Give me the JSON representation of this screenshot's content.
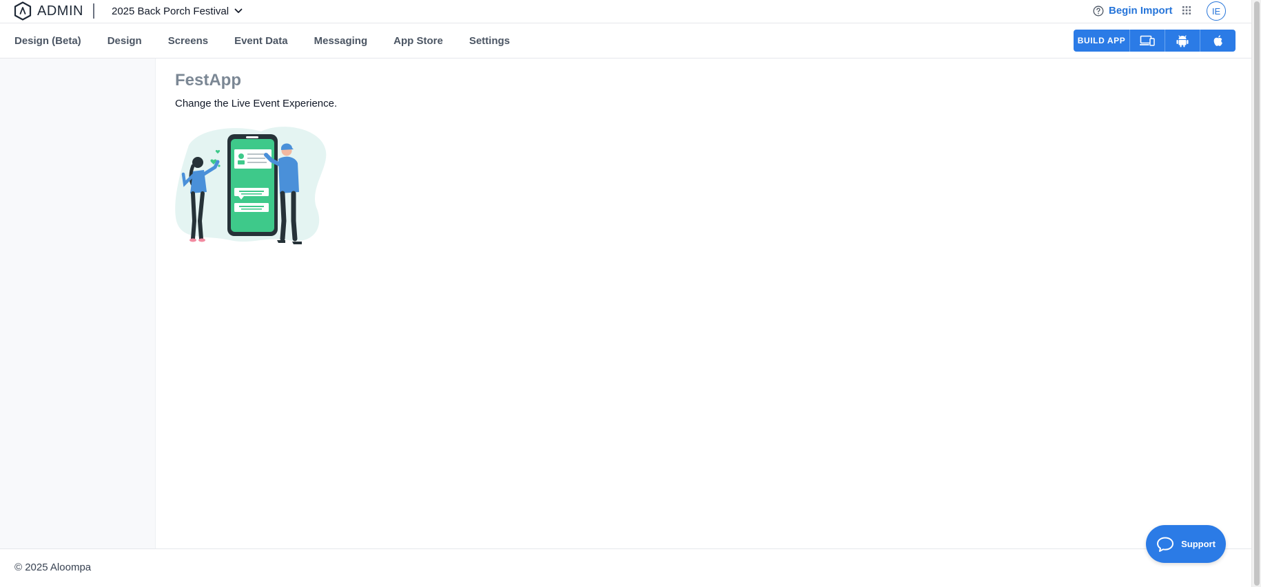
{
  "brand": {
    "logo_text": "ADMIN"
  },
  "project": {
    "selected": "2025 Back Porch Festival"
  },
  "header": {
    "help_label": "Begin Import",
    "avatar_initials": "IE"
  },
  "nav": {
    "tabs": [
      {
        "label": "Design (Beta)"
      },
      {
        "label": "Design"
      },
      {
        "label": "Screens"
      },
      {
        "label": "Event Data"
      },
      {
        "label": "Messaging"
      },
      {
        "label": "App Store"
      },
      {
        "label": "Settings"
      }
    ]
  },
  "build": {
    "label": "BUILD APP",
    "icons": [
      "devices-icon",
      "android-icon",
      "apple-icon"
    ]
  },
  "main": {
    "title": "FestApp",
    "subtitle": "Change the Live Event Experience."
  },
  "footer": {
    "copyright": "© 2025 Aloompa"
  },
  "support": {
    "label": "Support"
  },
  "colors": {
    "accent": "#2b7be6",
    "link": "#2574d9",
    "illustration_green": "#3ec98a",
    "illustration_blue": "#4a90d9"
  }
}
